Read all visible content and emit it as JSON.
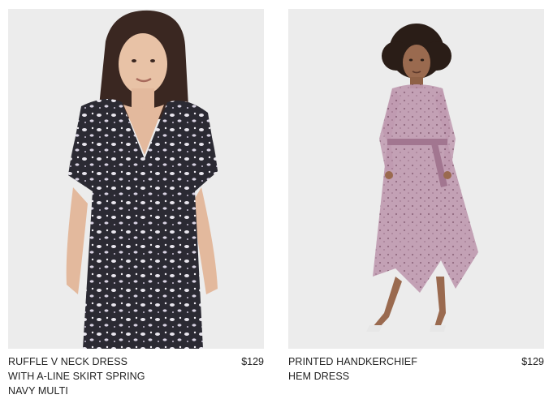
{
  "products": [
    {
      "name_lines": [
        "RUFFLE V NECK DRESS",
        "WITH A-LINE SKIRT SPRING",
        "NAVY MULTI"
      ],
      "price": "$129",
      "image_alt": "Model wearing a navy floral ruffle v-neck dress",
      "dress_color": "#2b2a33",
      "print_color": "#e9e6ee"
    },
    {
      "name_lines": [
        "PRINTED HANDKERCHIEF",
        "HEM DRESS"
      ],
      "price": "$129",
      "image_alt": "Model wearing a mauve printed handkerchief hem dress",
      "dress_color": "#b892a8",
      "print_color": "#8a5f78"
    }
  ],
  "colors": {
    "photo_background": "#ececec",
    "text": "#222222"
  }
}
